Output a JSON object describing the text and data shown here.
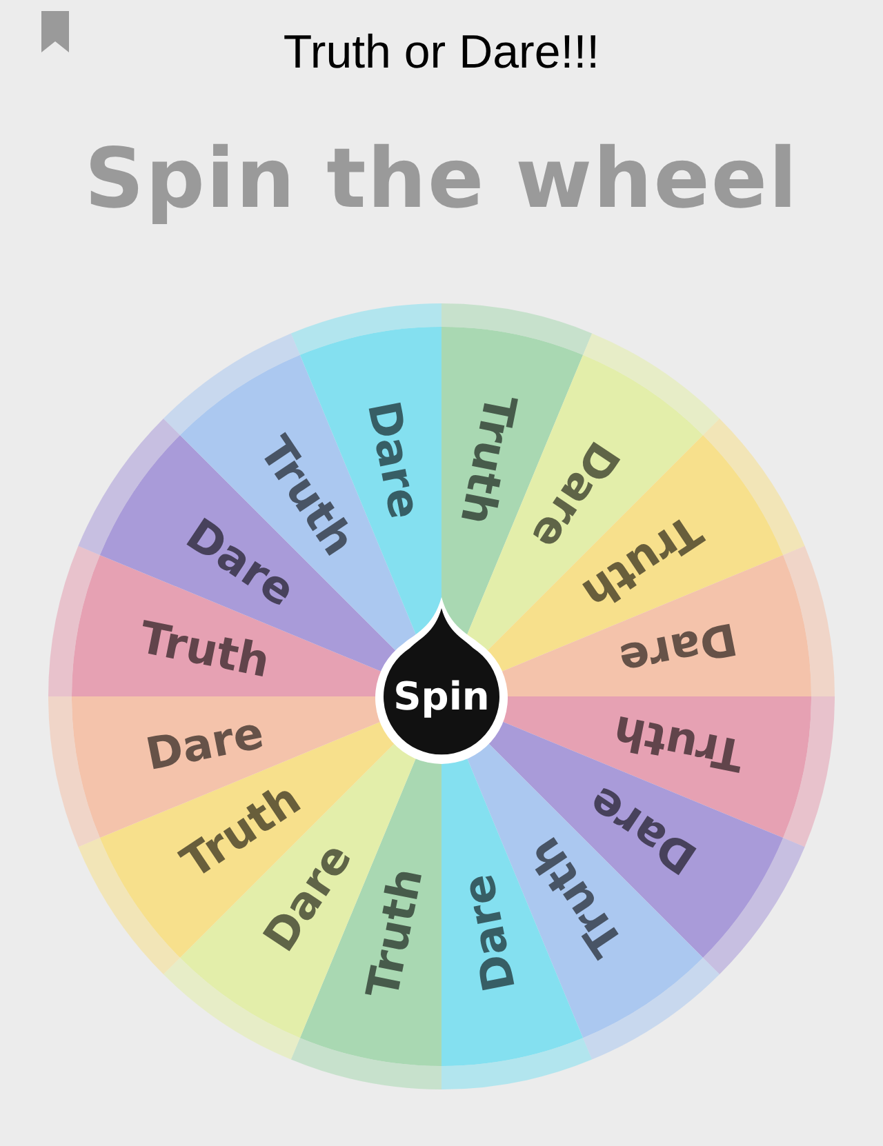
{
  "title": "Truth or Dare!!!",
  "heading": "Spin the wheel",
  "segments": [
    {
      "label": "Truth",
      "color": "#a9d8b2"
    },
    {
      "label": "Dare",
      "color": "#e3eeaa"
    },
    {
      "label": "Truth",
      "color": "#f7e08c"
    },
    {
      "label": "Dare",
      "color": "#f4c3ab"
    },
    {
      "label": "Truth",
      "color": "#e6a1b3"
    },
    {
      "label": "Dare",
      "color": "#a99bd9"
    },
    {
      "label": "Truth",
      "color": "#abc8f0"
    },
    {
      "label": "Dare",
      "color": "#84e0f0"
    },
    {
      "label": "Truth",
      "color": "#a9d8b2"
    },
    {
      "label": "Dare",
      "color": "#e3eeaa"
    },
    {
      "label": "Truth",
      "color": "#f7e08c"
    },
    {
      "label": "Dare",
      "color": "#f4c3ab"
    },
    {
      "label": "Truth",
      "color": "#e6a1b3"
    },
    {
      "label": "Dare",
      "color": "#a99bd9"
    },
    {
      "label": "Truth",
      "color": "#abc8f0"
    },
    {
      "label": "Dare",
      "color": "#84e0f0"
    }
  ],
  "spin_button": "Spin"
}
